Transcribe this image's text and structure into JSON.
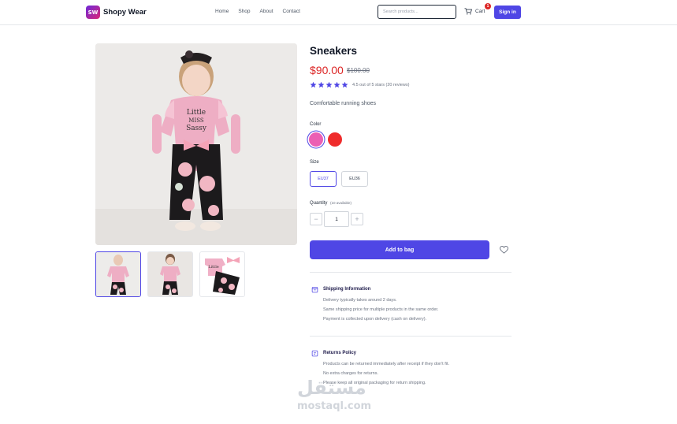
{
  "nav": {
    "logo_badge": "SW",
    "brand": "Shopy Wear",
    "links": [
      "Home",
      "Shop",
      "About",
      "Contact"
    ],
    "search_placeholder": "Search products...",
    "cart_label": "Cart",
    "cart_count": "1",
    "signin_label": "Sign in"
  },
  "product": {
    "title": "Sneakers",
    "price": "$90.00",
    "old_price": "$100.00",
    "rating": 4.5,
    "rating_text": "4.5 out of 5 stars (20 reviews)",
    "description": "Comfortable running shoes",
    "color_label": "Color",
    "colors": [
      {
        "name": "pink",
        "hex": "#ec5fb3"
      },
      {
        "name": "red",
        "hex": "#ef2b2b"
      }
    ],
    "size_label": "Size",
    "sizes": [
      "EU37",
      "EU36"
    ],
    "selected_size": "EU37",
    "quantity_label": "Quantity",
    "available_text": "(10 available)",
    "quantity": "1",
    "decrement": "−",
    "increment": "+",
    "add_to_bag": "Add to bag"
  },
  "shipping": {
    "title": "Shipping Information",
    "lines": [
      "Delivery typically takes around 2 days.",
      "Same shipping price for multiple products in the same order.",
      "Payment is collected upon delivery (cash on delivery)."
    ]
  },
  "returns": {
    "title": "Returns Policy",
    "lines": [
      "Products can be returned immediately after receipt if they don't fit.",
      "No extra charges for returns.",
      "Please keep all original packaging for return shipping."
    ]
  },
  "watermark": {
    "arabic": "مستقل",
    "domain": "mostaql.com"
  },
  "colors": {
    "accent": "#4f46e5",
    "price": "#dc2626",
    "star": "#4f46e5"
  }
}
